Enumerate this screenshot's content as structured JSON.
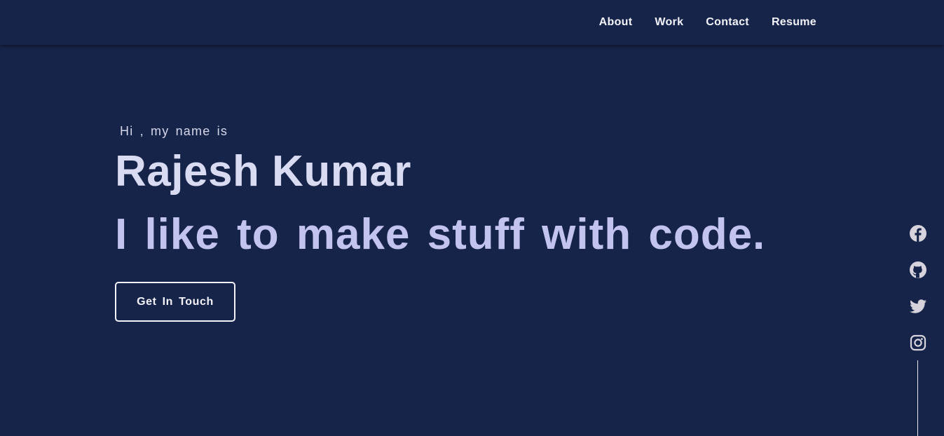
{
  "nav": {
    "links": [
      {
        "label": "About"
      },
      {
        "label": "Work"
      },
      {
        "label": "Contact"
      },
      {
        "label": "Resume"
      }
    ]
  },
  "hero": {
    "greeting": "Hi , my name is",
    "name": "Rajesh Kumar",
    "tagline": "I like to make stuff with code.",
    "cta_label": "Get In Touch"
  },
  "social": {
    "icons": [
      "facebook-icon",
      "github-icon",
      "twitter-icon",
      "instagram-icon"
    ]
  },
  "colors": {
    "background": "#17244a",
    "nav_text": "#f2f3fa",
    "name": "#d9dbf3",
    "tagline": "#c3c3f0",
    "icon": "#d7d3dc"
  }
}
